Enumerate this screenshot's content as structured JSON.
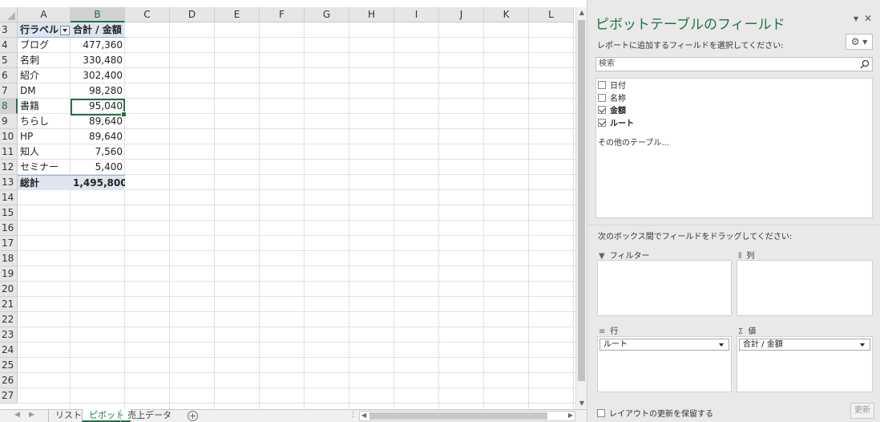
{
  "sheet": {
    "columns": [
      "A",
      "B",
      "C",
      "D",
      "E",
      "F",
      "G",
      "H",
      "I",
      "J",
      "K",
      "L"
    ],
    "selected_column": "B",
    "row_numbers": [
      "3",
      "4",
      "5",
      "6",
      "7",
      "8",
      "9",
      "10",
      "11",
      "12",
      "13",
      "14",
      "15",
      "16",
      "17",
      "18",
      "19",
      "20",
      "21",
      "22",
      "23",
      "24",
      "25",
      "26",
      "27"
    ],
    "selected_row": "8",
    "pivot": {
      "header_label": "行ラベル",
      "header_value": "合計 / 金額",
      "rows": [
        {
          "label": "ブログ",
          "value": "477,360"
        },
        {
          "label": "名刺",
          "value": "330,480"
        },
        {
          "label": "紹介",
          "value": "302,400"
        },
        {
          "label": "DM",
          "value": "98,280"
        },
        {
          "label": "書籍",
          "value": "95,040"
        },
        {
          "label": "ちらし",
          "value": "89,640"
        },
        {
          "label": "HP",
          "value": "89,640"
        },
        {
          "label": "知人",
          "value": "7,560"
        },
        {
          "label": "セミナー",
          "value": "5,400"
        }
      ],
      "total_label": "総計",
      "total_value": "1,495,800"
    },
    "tabs": [
      "リスト",
      "ピボット",
      "売上データ"
    ],
    "active_tab": "ピボット",
    "add_sheet": "+"
  },
  "pane": {
    "title": "ピボットテーブルのフィールド",
    "dropdown_glyph": "▾",
    "close_glyph": "✕",
    "subtitle": "レポートに追加するフィールドを選択してください:",
    "gear_glyph": "⚙ ▾",
    "search_placeholder": "検索",
    "fields": [
      {
        "label": "日付",
        "checked": false
      },
      {
        "label": "名称",
        "checked": false
      },
      {
        "label": "金額",
        "checked": true
      },
      {
        "label": "ルート",
        "checked": true
      }
    ],
    "more_tables": "その他のテーブル...",
    "drag_hint": "次のボックス間でフィールドをドラッグしてください:",
    "areas": {
      "filter": {
        "label": "フィルター",
        "icon": "▼"
      },
      "columns": {
        "label": "列",
        "icon": "⦀"
      },
      "rows": {
        "label": "行",
        "icon": "≡",
        "item": "ルート"
      },
      "values": {
        "label": "値",
        "icon": "Σ",
        "item": "合計 / 金額"
      }
    },
    "defer_label": "レイアウトの更新を保留する",
    "update_label": "更新"
  }
}
